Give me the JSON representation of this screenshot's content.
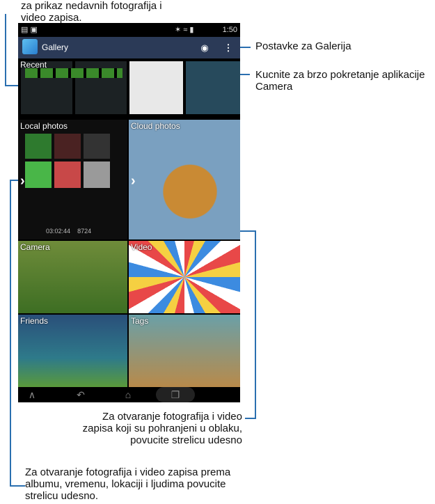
{
  "annotations": {
    "recent": "za prikaz nedavnih fotografija i video zapisa.",
    "settings": "Postavke za Galerija",
    "camera": "Kucnite za brzo pokretanje aplikacije Camera",
    "cloud": "Za otvaranje fotografija i video zapisa koji su pohranjeni u oblaku, povucite strelicu udesno",
    "local": "Za otvaranje fotografija i video zapisa prema albumu, vremenu, lokaciji i ljudima povucite strelicu udesno."
  },
  "statusbar": {
    "time": "1:50"
  },
  "actionbar": {
    "title": "Gallery"
  },
  "tiles": {
    "recent": "Recent",
    "local": "Local photos",
    "cloud": "Cloud photos",
    "camera": "Camera",
    "video": "Video",
    "friends": "Friends",
    "tags": "Tags"
  },
  "local_stats": {
    "duration": "03:02:44",
    "count": "8724"
  },
  "icons": [
    "image-icon",
    "camera-icon",
    "overflow-menu-icon",
    "chevron-right-icon",
    "home-icon",
    "back-icon",
    "recent-apps-icon",
    "up-icon"
  ]
}
